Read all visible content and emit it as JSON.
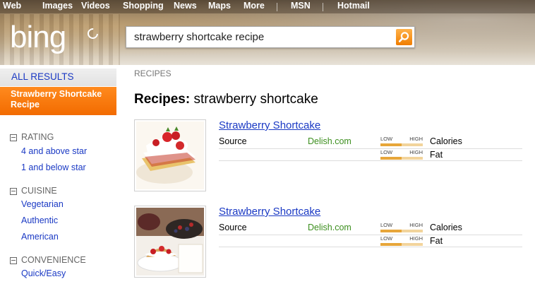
{
  "nav": {
    "items": [
      "Web",
      "Images",
      "Videos",
      "Shopping",
      "News",
      "Maps",
      "More",
      "MSN",
      "Hotmail"
    ]
  },
  "logo": {
    "text": "bing"
  },
  "search": {
    "query": "strawberry shortcake recipe",
    "button_icon": "magnifier-icon"
  },
  "sidebar": {
    "all_results": "ALL RESULTS",
    "active": "Strawberry Shortcake Recipe",
    "facets": [
      {
        "heading": "RATING",
        "links": [
          "4 and above star",
          "1 and below star"
        ]
      },
      {
        "heading": "CUISINE",
        "links": [
          "Vegetarian",
          "Authentic",
          "American"
        ]
      },
      {
        "heading": "CONVENIENCE",
        "links": [
          "Quick/Easy"
        ]
      }
    ]
  },
  "main": {
    "section_label": "RECIPES",
    "title_prefix": "Recipes:",
    "title_query": "strawberry shortcake",
    "results": [
      {
        "title": "Strawberry Shortcake",
        "source_label": "Source",
        "source": "Delish.com",
        "meters": [
          {
            "low": "LOW",
            "high": "HIGH",
            "label": "Calories",
            "level": 0.5
          },
          {
            "low": "LOW",
            "high": "HIGH",
            "label": "Fat",
            "level": 0.5
          }
        ]
      },
      {
        "title": "Strawberry Shortcake",
        "source_label": "Source",
        "source": "Delish.com",
        "meters": [
          {
            "low": "LOW",
            "high": "HIGH",
            "label": "Calories",
            "level": 0.5
          },
          {
            "low": "LOW",
            "high": "HIGH",
            "label": "Fat",
            "level": 0.5
          }
        ]
      }
    ]
  },
  "colors": {
    "link": "#1a39c4",
    "accent_orange": "#f26b00",
    "source_green": "#3d8f1f",
    "meter_fill": "#e7a63a"
  }
}
